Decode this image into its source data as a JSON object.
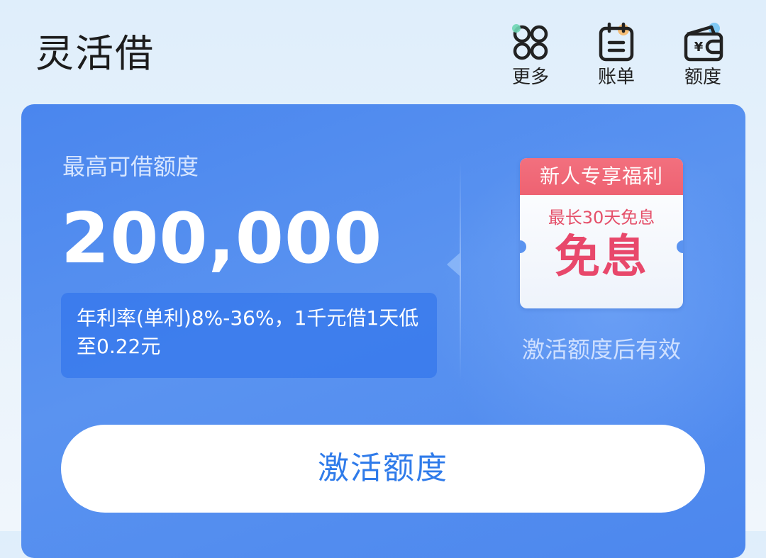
{
  "header": {
    "title": "灵活借",
    "actions": [
      {
        "label": "更多",
        "icon": "more-grid-icon"
      },
      {
        "label": "账单",
        "icon": "bill-icon"
      },
      {
        "label": "额度",
        "icon": "wallet-icon"
      }
    ]
  },
  "card": {
    "limit_label": "最高可借额度",
    "limit_amount": "200,000",
    "rate_text": "年利率(单利)8%-36%，1千元借1天低至0.22元",
    "coupon": {
      "header": "新人专享福利",
      "subtitle": "最长30天免息",
      "main": "免息"
    },
    "coupon_note": "激活额度后有效",
    "activate_button": "激活额度"
  },
  "colors": {
    "card_blue": "#4a86ee",
    "coupon_red": "#ee6272",
    "button_text_blue": "#2f7bea"
  }
}
